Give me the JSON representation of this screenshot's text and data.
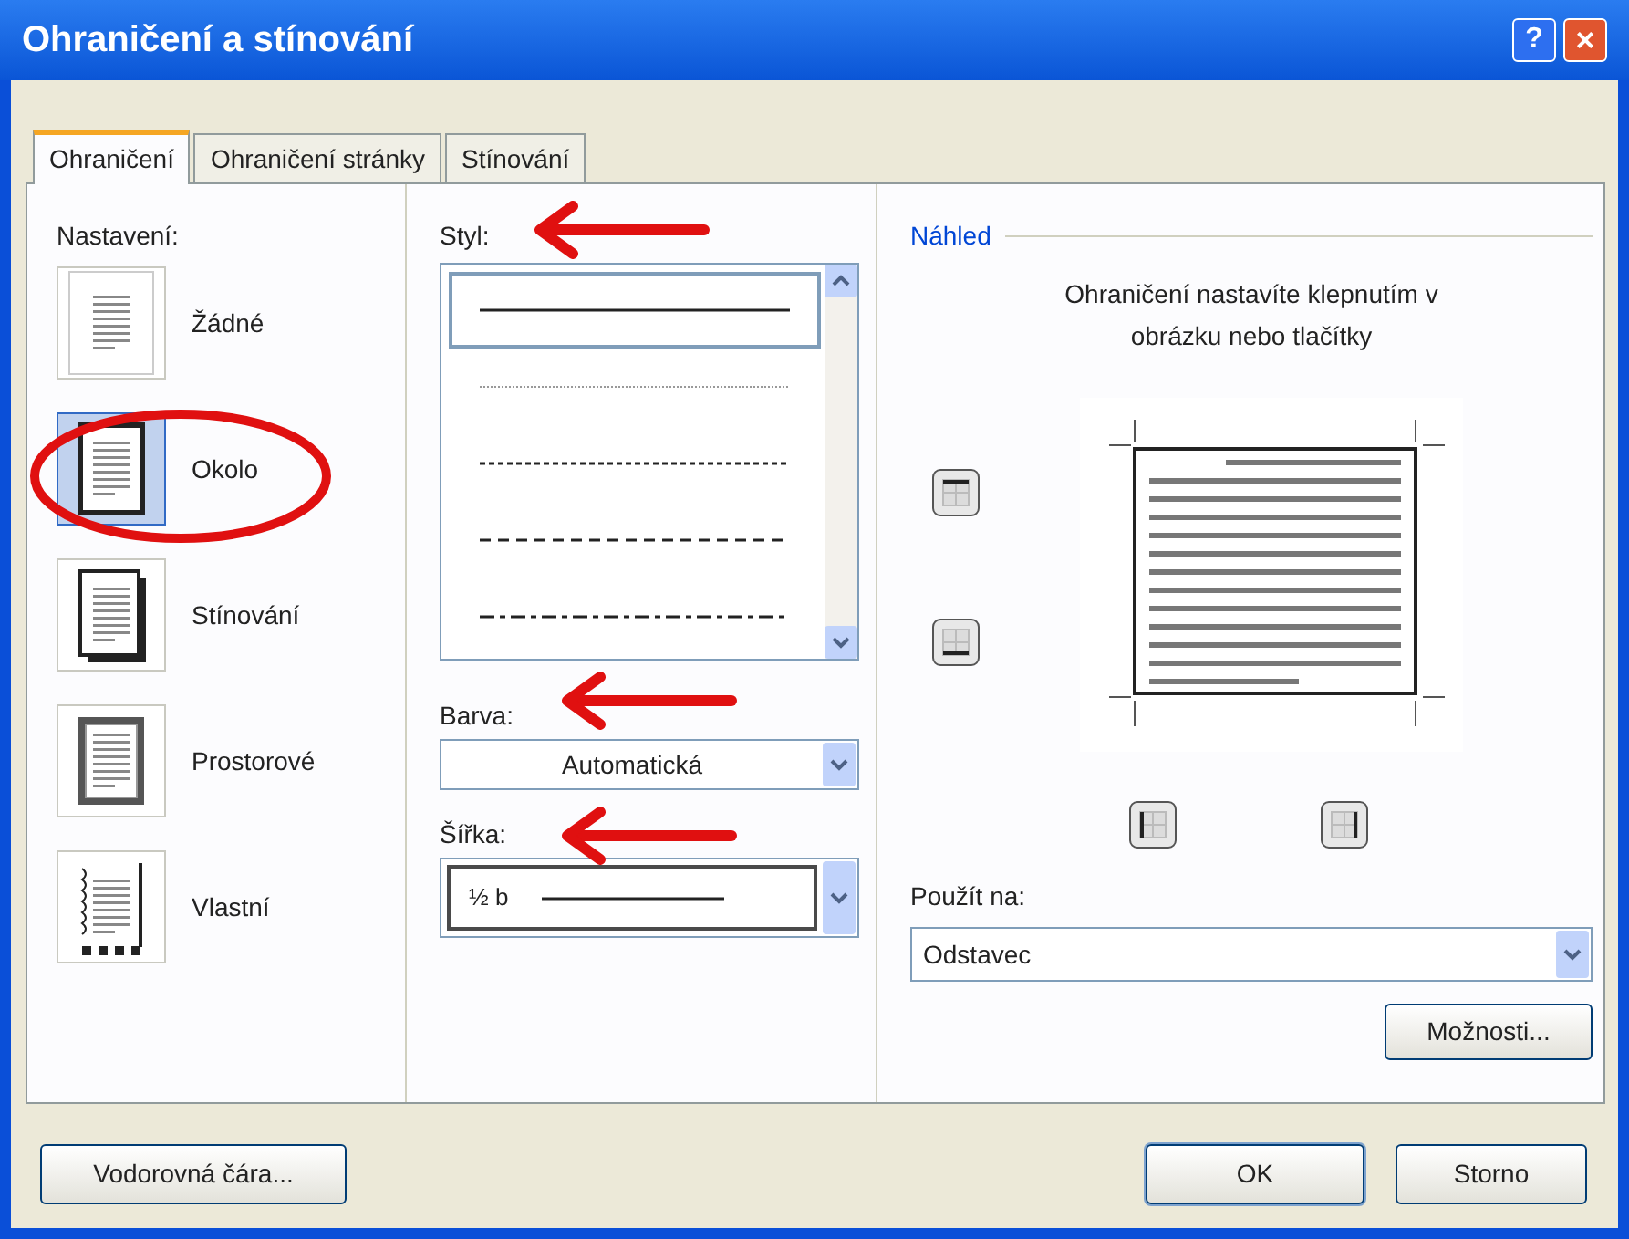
{
  "window": {
    "title": "Ohraničení a stínování",
    "help_button": "?",
    "close_button": "×"
  },
  "tabs": [
    {
      "label": "Ohraničení",
      "selected": true
    },
    {
      "label": "Ohraničení stránky",
      "selected": false
    },
    {
      "label": "Stínování",
      "selected": false
    }
  ],
  "settings": {
    "label": "Nastavení:",
    "items": [
      {
        "kind": "none",
        "label": "Žádné",
        "selected": false
      },
      {
        "kind": "box",
        "label": "Okolo",
        "selected": true
      },
      {
        "kind": "shadow",
        "label": "Stínování",
        "selected": false
      },
      {
        "kind": "threed",
        "label": "Prostorové",
        "selected": false
      },
      {
        "kind": "custom",
        "label": "Vlastní",
        "selected": false
      }
    ]
  },
  "style": {
    "label": "Styl:",
    "items": [
      {
        "kind": "solid",
        "selected": true
      },
      {
        "kind": "dotted",
        "selected": false
      },
      {
        "kind": "dashed-small",
        "selected": false
      },
      {
        "kind": "dashed",
        "selected": false
      },
      {
        "kind": "dash-dot",
        "selected": false
      }
    ]
  },
  "color": {
    "label": "Barva:",
    "value": "Automatická"
  },
  "width": {
    "label": "Šířka:",
    "value": "½ b"
  },
  "preview": {
    "title": "Náhled",
    "hint": "Ohraničení nastavíte klepnutím v obrázku nebo tlačítky",
    "buttons": [
      {
        "kind": "top"
      },
      {
        "kind": "bottom"
      },
      {
        "kind": "left"
      },
      {
        "kind": "right"
      }
    ]
  },
  "apply_to": {
    "label": "Použít na:",
    "value": "Odstavec"
  },
  "options_button": "Možnosti...",
  "footer": {
    "horizontal_line_button": "Vodorovná čára...",
    "ok_button": "OK",
    "cancel_button": "Storno"
  },
  "annotations": [
    {
      "kind": "circle"
    },
    {
      "kind": "arrow"
    },
    {
      "kind": "arrow"
    },
    {
      "kind": "arrow"
    }
  ]
}
